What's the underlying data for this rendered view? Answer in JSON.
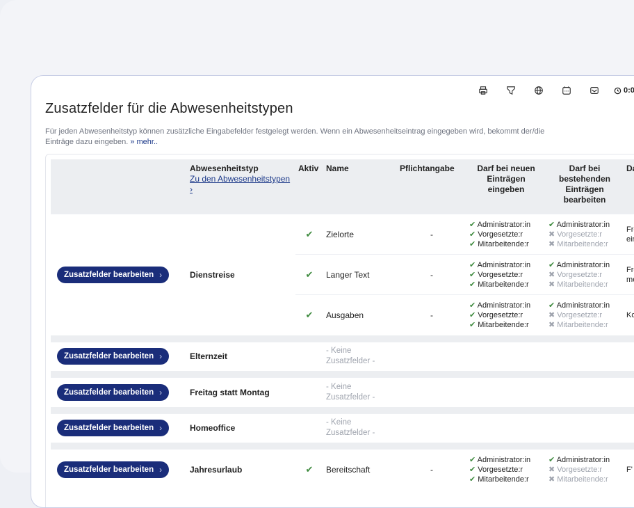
{
  "toolbar": {
    "icons": [
      "printer-icon",
      "funnel-icon",
      "globe-icon",
      "calendar-icon",
      "mail-icon"
    ],
    "timer": "0:0"
  },
  "page": {
    "title": "Zusatzfelder für die Abwesenheitstypen",
    "intro": "Für jeden Abwesenheitstyp können zusätzliche Eingabefelder festgelegt werden. Wenn ein Abwesenheitseintrag eingegeben wird, bekommt der/die",
    "intro2": "Einträge dazu eingeben.",
    "more": "» mehr.."
  },
  "table": {
    "headers": {
      "typ": "Abwesenheitstyp",
      "typ_link": "Zu den Abwesenheitstypen ›",
      "aktiv": "Aktiv",
      "name": "Name",
      "pflicht": "Pflichtangabe",
      "neu": "Darf bei neuen Einträgen eingeben",
      "bestehend": "Darf bei bestehenden Einträgen bearbeiten",
      "extra": "Da"
    },
    "button_label": "Zusatzfelder bearbeiten",
    "button_chevron": "›",
    "none_line1": "- Keine",
    "none_line2": "Zusatzfelder -",
    "perm_labels": [
      "Administrator:in",
      "Vorgesetzte:r",
      "Mitarbeitende:r"
    ],
    "dienstreise": {
      "type": "Dienstreise",
      "fields": [
        {
          "name": "Zielorte",
          "pflicht": "-",
          "extra1": "Fre",
          "extra2": "ein"
        },
        {
          "name": "Langer Text",
          "pflicht": "-",
          "extra1": "Fre",
          "extra2": "me"
        },
        {
          "name": "Ausgaben",
          "pflicht": "-",
          "extra1": "Ko",
          "extra2": ""
        }
      ]
    },
    "elternzeit": "Elternzeit",
    "freitag": "Freitag statt Montag",
    "homeoffice": "Homeoffice",
    "jahresurlaub": {
      "type": "Jahresurlaub",
      "name": "Bereitschaft",
      "pflicht": "-",
      "extra1": "F'"
    }
  }
}
